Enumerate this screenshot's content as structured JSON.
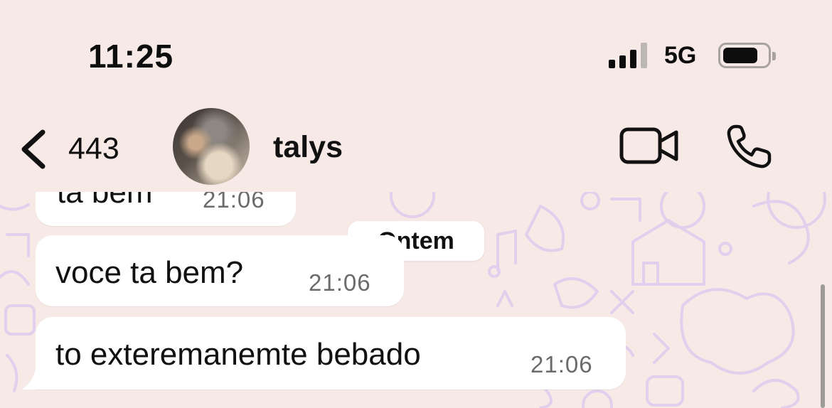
{
  "status_bar": {
    "time": "11:25",
    "network": "5G",
    "signal_bars_active": 3,
    "signal_bars_total": 4,
    "battery_level": 0.75
  },
  "header": {
    "back_count": "443",
    "contact_name": "talys",
    "icons": [
      "chevron-left-icon",
      "avatar",
      "video-call-icon",
      "phone-icon"
    ]
  },
  "chat": {
    "date_separator": "Ontem",
    "messages": [
      {
        "text": "ta bem",
        "time": "21:06"
      },
      {
        "text": "voce ta bem?",
        "time": "21:06"
      },
      {
        "text": "to exteremanemte bebado",
        "time": "21:06"
      }
    ]
  },
  "colors": {
    "background": "#f7e9e5",
    "bubble": "#ffffff",
    "wallpaper_doodle": "#e2cfee",
    "text": "#111111",
    "timestamp": "#6b6b6b"
  }
}
